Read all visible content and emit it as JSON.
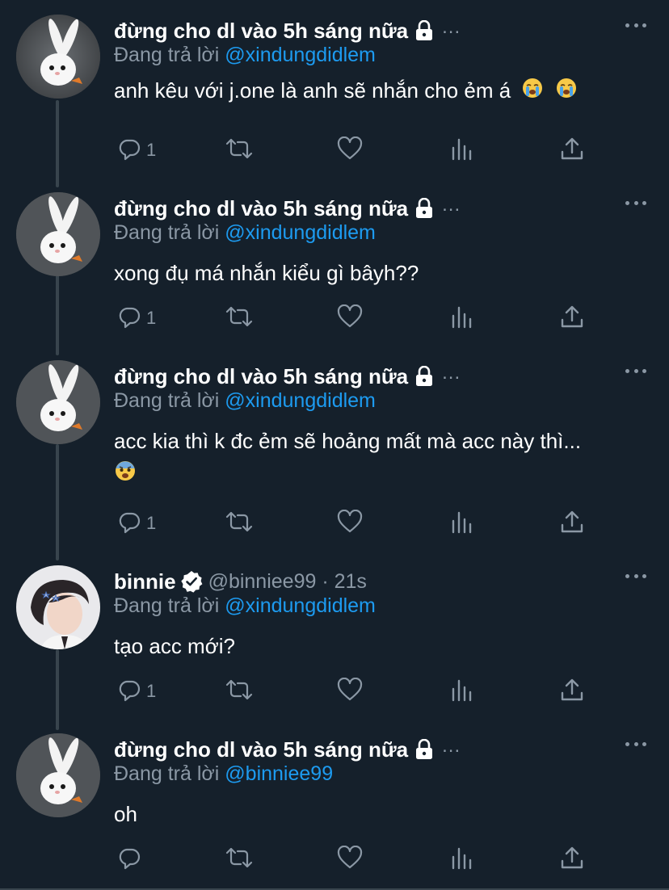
{
  "thread": {
    "tweets": [
      {
        "name": "đừng cho dl vào 5h sáng nữa",
        "locked": true,
        "verified": false,
        "handle": "",
        "time": "",
        "dots": "...",
        "replying_prefix": "Đang trả lời ",
        "replying_to": "@xindungdidlem",
        "text": "anh kêu với j.one là anh sẽ nhắn cho ẻm á",
        "emojis": [
          "loudly-crying-face",
          "loudly-crying-face"
        ],
        "reply_count": "1",
        "avatar": "white-rabbit"
      },
      {
        "name": "đừng cho dl vào 5h sáng nữa",
        "locked": true,
        "verified": false,
        "handle": "",
        "time": "",
        "dots": "...",
        "replying_prefix": "Đang trả lời ",
        "replying_to": "@xindungdidlem",
        "text": "xong đụ má nhắn kiểu gì bâyh??",
        "emojis": [],
        "reply_count": "1",
        "avatar": "white-rabbit"
      },
      {
        "name": "đừng cho dl vào 5h sáng nữa",
        "locked": true,
        "verified": false,
        "handle": "",
        "time": "",
        "dots": "...",
        "replying_prefix": "Đang trả lời ",
        "replying_to": "@xindungdidlem",
        "text": "acc kia thì k đc ẻm sẽ hoảng mất mà acc này thì...",
        "emojis": [
          "fearful-face"
        ],
        "reply_count": "1",
        "avatar": "white-rabbit"
      },
      {
        "name": "binnie",
        "locked": false,
        "verified": true,
        "handle": "@binniee99 · 21s",
        "time": "21s",
        "dots": "",
        "replying_prefix": "Đang trả lời ",
        "replying_to": "@xindungdidlem",
        "text": "tạo acc mới?",
        "emojis": [],
        "reply_count": "1",
        "avatar": "person-photo"
      },
      {
        "name": "đừng cho dl vào 5h sáng nữa",
        "locked": true,
        "verified": false,
        "handle": "",
        "time": "",
        "dots": "...",
        "replying_prefix": "Đang trả lời ",
        "replying_to": "@binniee99",
        "text": "oh",
        "emojis": [],
        "reply_count": "",
        "avatar": "white-rabbit"
      }
    ]
  },
  "icons": {
    "reply": "reply-icon",
    "retweet": "retweet-icon",
    "like": "heart-icon",
    "views": "analytics-icon",
    "share": "share-icon",
    "more": "more-icon",
    "lock": "lock-icon",
    "verified": "verified-badge-icon"
  },
  "colors": {
    "background": "#15202b",
    "text": "#ffffff",
    "secondary": "#8b98a5",
    "mention": "#1d9bf0",
    "thread_line": "#38444d"
  }
}
